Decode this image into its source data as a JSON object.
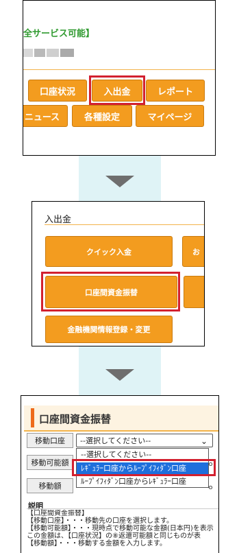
{
  "panel1": {
    "status_text": "全サービス可能】",
    "menu_row1": [
      "口座状況",
      "入出金",
      "レポート"
    ],
    "menu_row2": [
      "ニュース",
      "各種設定",
      "マイページ"
    ],
    "highlighted_item": "入出金"
  },
  "panel2": {
    "title": "入出金",
    "buttons": [
      "クイック入金",
      "お",
      "口座間資金振替",
      "",
      "金融機関情報登録・変更"
    ],
    "highlighted_item": "口座間資金振替"
  },
  "panel3": {
    "title": "口座間資金振替",
    "fields": {
      "move_account_label": "移動口座",
      "move_account_select_value": "--選択してください--",
      "movable_amount_label": "移動可能額",
      "move_amount_label": "移動額"
    },
    "dropdown_options": [
      "--選択してください--",
      "ﾚｷﾞｭﾗｰ口座からﾙｰﾌﾟｲﾌｨﾀﾞﾝ口座",
      "ﾙｰﾌﾟｲﾌｨﾀﾞﾝ口座からﾚｷﾞｭﾗｰ口座"
    ],
    "selected_option_index": 1,
    "description_heading": "説明",
    "description_lines": [
      "【口座間資金振替】",
      "【移動口座】・・・移動先の口座を選択します。",
      "【移動可能額】・・・現時点で移動可能な金額(日本円)を表示",
      "この金額は、【口座状況】の⑧返還可能額と同じものが表",
      "【移動額】・・・移動する金額を入力します。"
    ]
  },
  "colors": {
    "orange_button": "#f39c1f",
    "highlight_red": "#d2202f",
    "arrow_band": "#dff3f6",
    "arrow": "#6e6e6e",
    "status_green": "#2f9a2f",
    "dropdown_selected": "#1e6fdc"
  }
}
